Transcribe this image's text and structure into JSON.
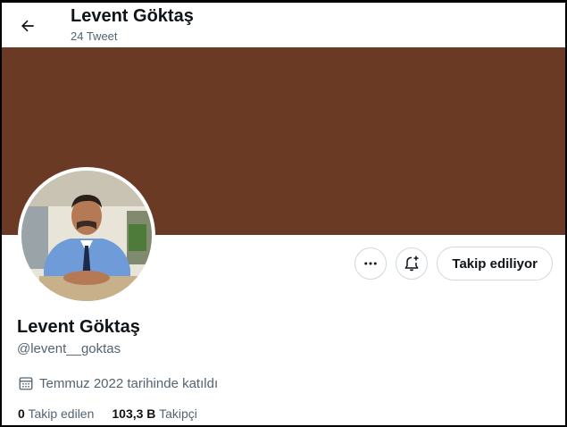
{
  "header": {
    "name": "Levent Göktaş",
    "tweet_count": "24 Tweet"
  },
  "colors": {
    "banner": "#6b3a25",
    "border": "#cfd9de",
    "muted": "#536471"
  },
  "profile": {
    "name": "Levent Göktaş",
    "handle": "@levent__goktas",
    "joined": "Temmuz 2022 tarihinde katıldı"
  },
  "actions": {
    "follow_label": "Takip ediliyor"
  },
  "stats": {
    "following_count": "0",
    "following_label": "Takip edilen",
    "followers_count": "103,3 B",
    "followers_label": "Takipçi"
  },
  "icons": {
    "back": "arrow-left-icon",
    "more": "more-icon",
    "notify": "bell-plus-icon",
    "calendar": "calendar-icon"
  }
}
